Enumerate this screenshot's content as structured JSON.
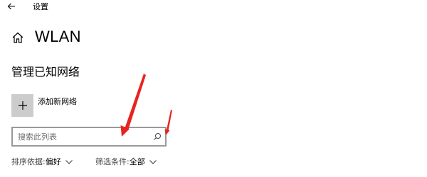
{
  "window": {
    "title": "设置"
  },
  "page": {
    "title": "WLAN"
  },
  "known_networks": {
    "heading": "管理已知网络",
    "add_label": "添加新网络",
    "search": {
      "placeholder": "搜索此列表",
      "value": ""
    },
    "sort": {
      "label": "排序依据:",
      "value": "偏好"
    },
    "filter": {
      "label": "筛选条件:",
      "value": "全部"
    }
  },
  "colors": {
    "add_tile": "#cccccc",
    "search_border": "#999999",
    "annotation_arrow": "#e8231f"
  },
  "icons": {
    "back": "back-arrow-icon",
    "home": "home-icon",
    "add": "plus-icon",
    "search": "search-icon",
    "dropdown": "chevron-down-icon"
  }
}
